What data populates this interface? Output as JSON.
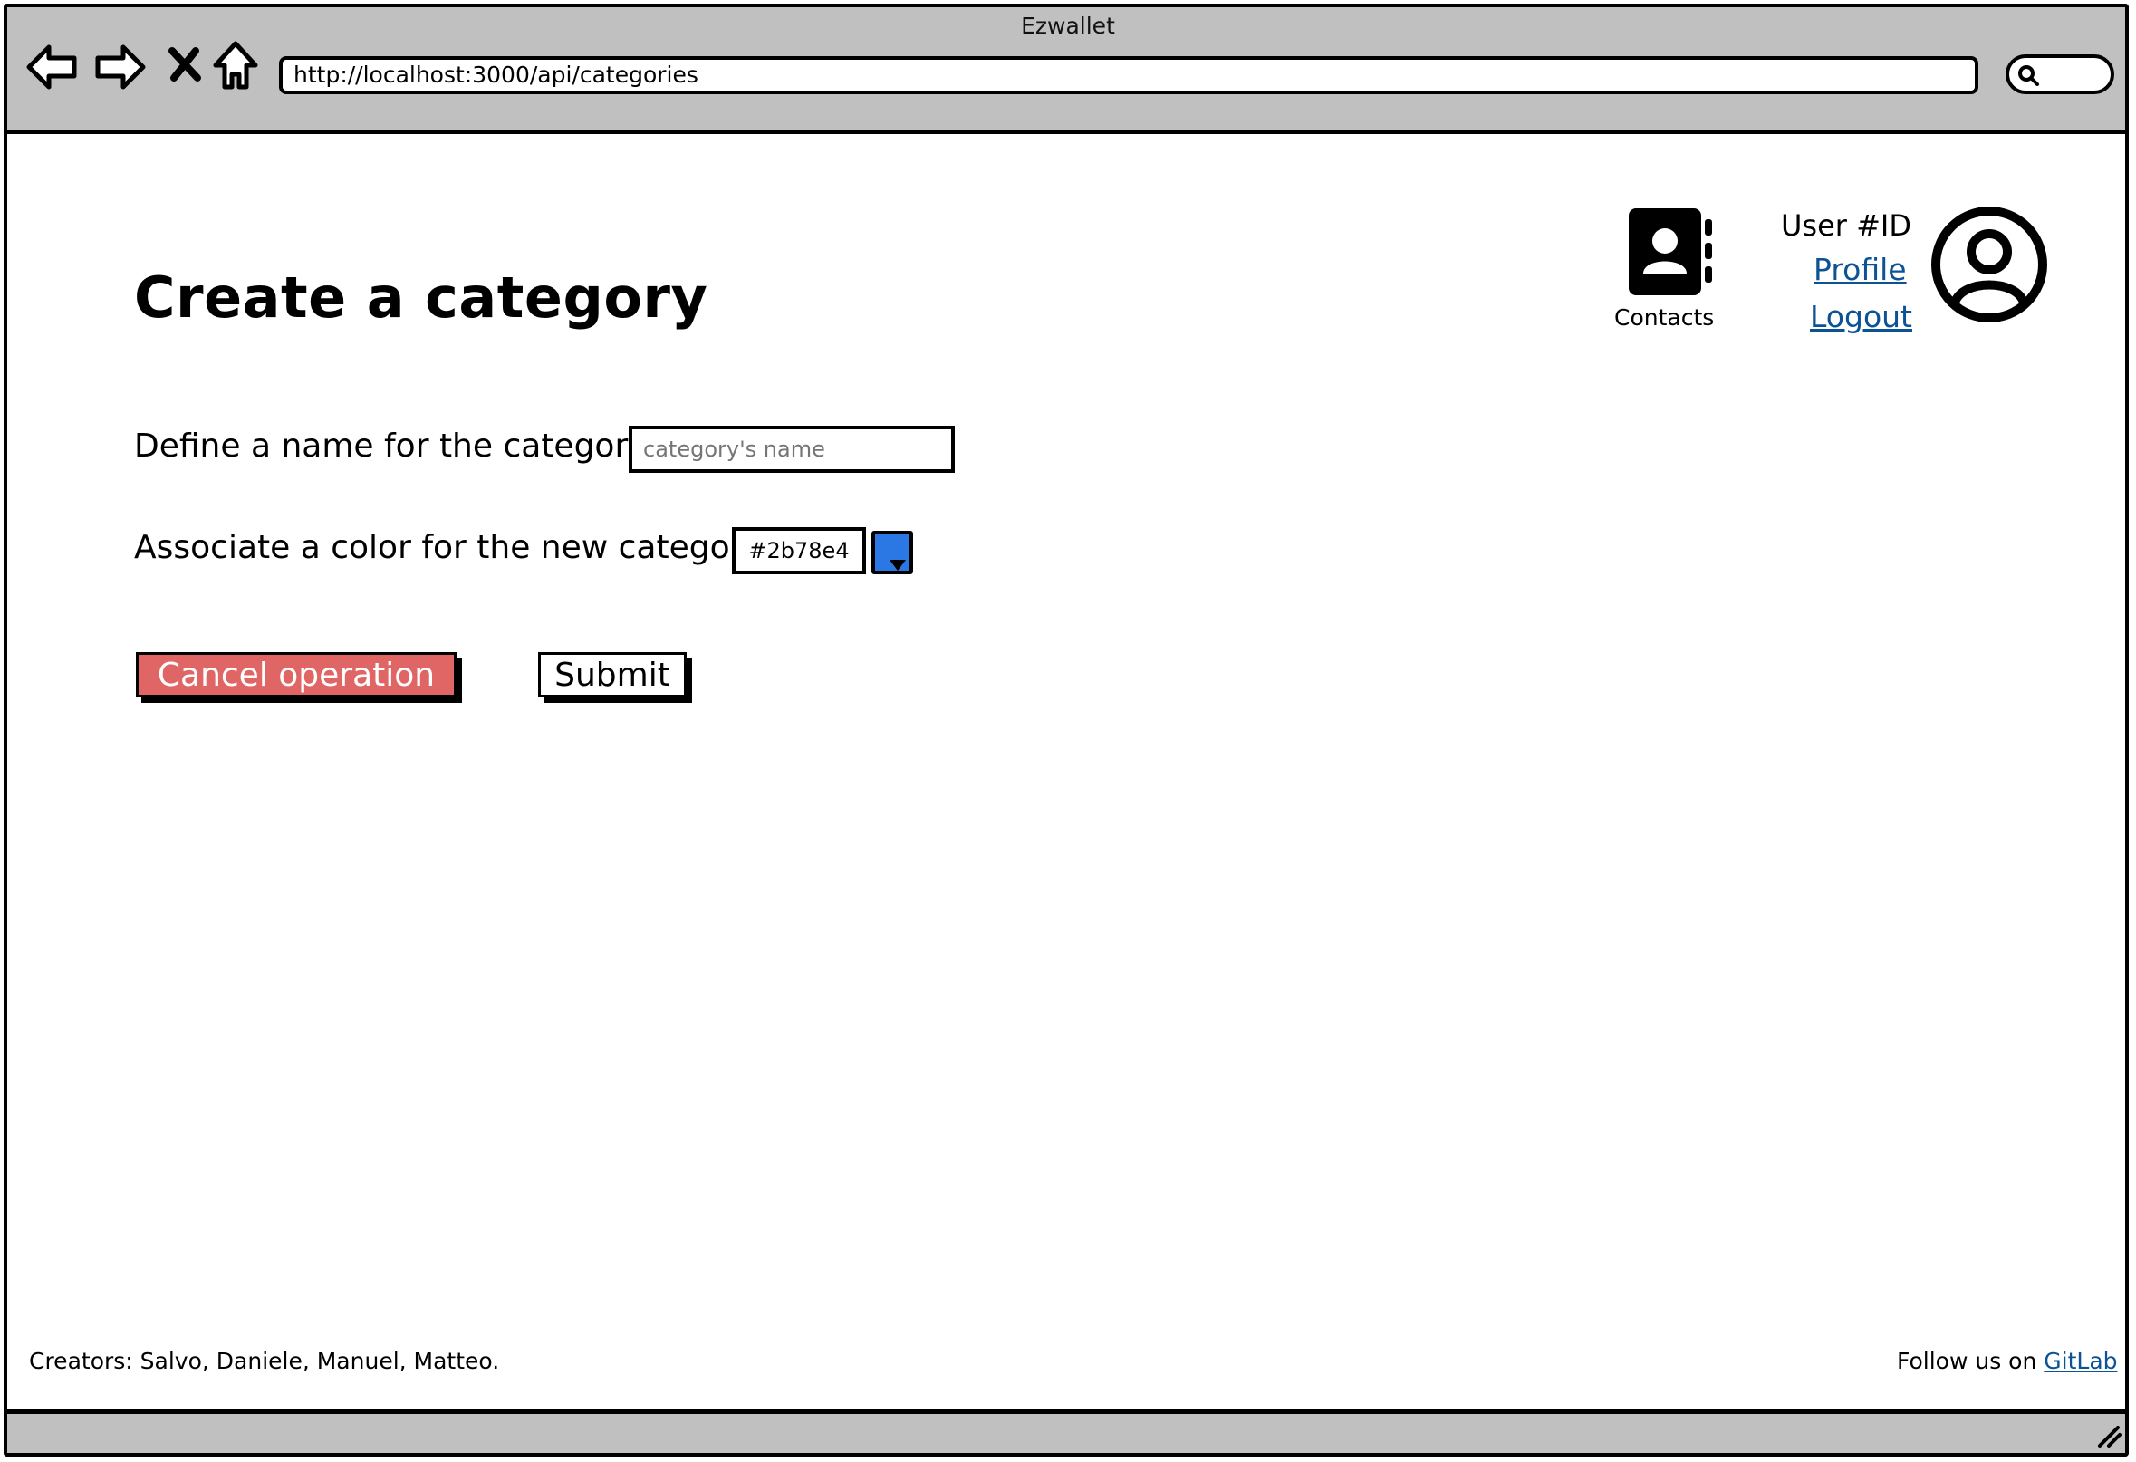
{
  "window": {
    "title": "Ezwallet"
  },
  "browser": {
    "url": "http://localhost:3000/api/categories",
    "icons": [
      "back-arrow-icon",
      "forward-arrow-icon",
      "close-icon",
      "home-icon",
      "search-icon"
    ]
  },
  "header": {
    "contacts_label": "Contacts",
    "user_id": "User #ID",
    "profile_link": "Profile",
    "logout_link": "Logout",
    "icons": [
      "contacts-book-icon",
      "user-avatar-icon"
    ]
  },
  "main": {
    "title": "Create a category",
    "name_label": "Define a name for the category:",
    "name_placeholder": "category's name",
    "color_label": "Associate a color for the new category:",
    "color_value": "#2b78e4",
    "cancel_label": "Cancel operation",
    "submit_label": "Submit"
  },
  "footer": {
    "creators": "Creators: Salvo, Daniele, Manuel, Matteo.",
    "follow_text": "Follow us on",
    "gitlab_link": "GitLab"
  },
  "colors": {
    "cancel_bg": "#e06666",
    "link": "#0b5394",
    "chrome": "#c0c0c0",
    "swatch": "#2b78e4"
  }
}
